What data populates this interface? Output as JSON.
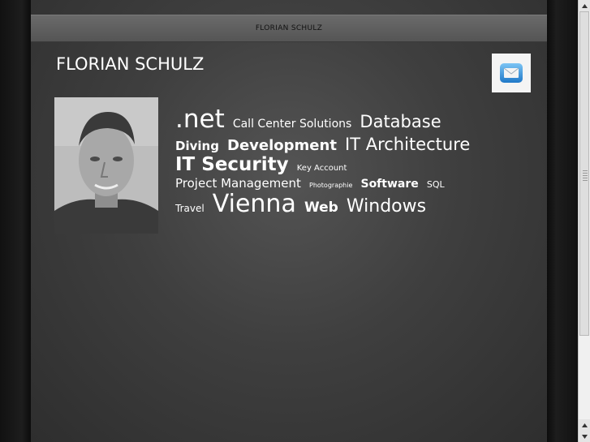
{
  "header": {
    "bar_title": "FLORIAN SCHULZ",
    "site_title": "FLORIAN SCHULZ"
  },
  "contact": {
    "icon": "mail-icon"
  },
  "profile": {
    "photo": "profile-photo"
  },
  "tags": [
    {
      "label": ".net",
      "size": 31,
      "weight": "normal"
    },
    {
      "label": "Call Center Solutions",
      "size": 14,
      "weight": "normal"
    },
    {
      "label": "Database",
      "size": 21,
      "weight": "normal"
    },
    {
      "label": "Diving",
      "size": 15,
      "weight": "bold"
    },
    {
      "label": "Development",
      "size": 18,
      "weight": "bold"
    },
    {
      "label": "IT Architecture",
      "size": 21,
      "weight": "normal"
    },
    {
      "label": "IT Security",
      "size": 23,
      "weight": "bold"
    },
    {
      "label": "Key Account",
      "size": 10,
      "weight": "normal"
    },
    {
      "label": "Project Management",
      "size": 15,
      "weight": "normal"
    },
    {
      "label": "Photographie",
      "size": 8,
      "weight": "normal"
    },
    {
      "label": "Software",
      "size": 14,
      "weight": "bold"
    },
    {
      "label": "SQL",
      "size": 11,
      "weight": "normal"
    },
    {
      "label": "Travel",
      "size": 12,
      "weight": "normal"
    },
    {
      "label": "Vienna",
      "size": 30,
      "weight": "normal"
    },
    {
      "label": "Web",
      "size": 17,
      "weight": "bold"
    },
    {
      "label": "Windows",
      "size": 22,
      "weight": "normal"
    }
  ]
}
